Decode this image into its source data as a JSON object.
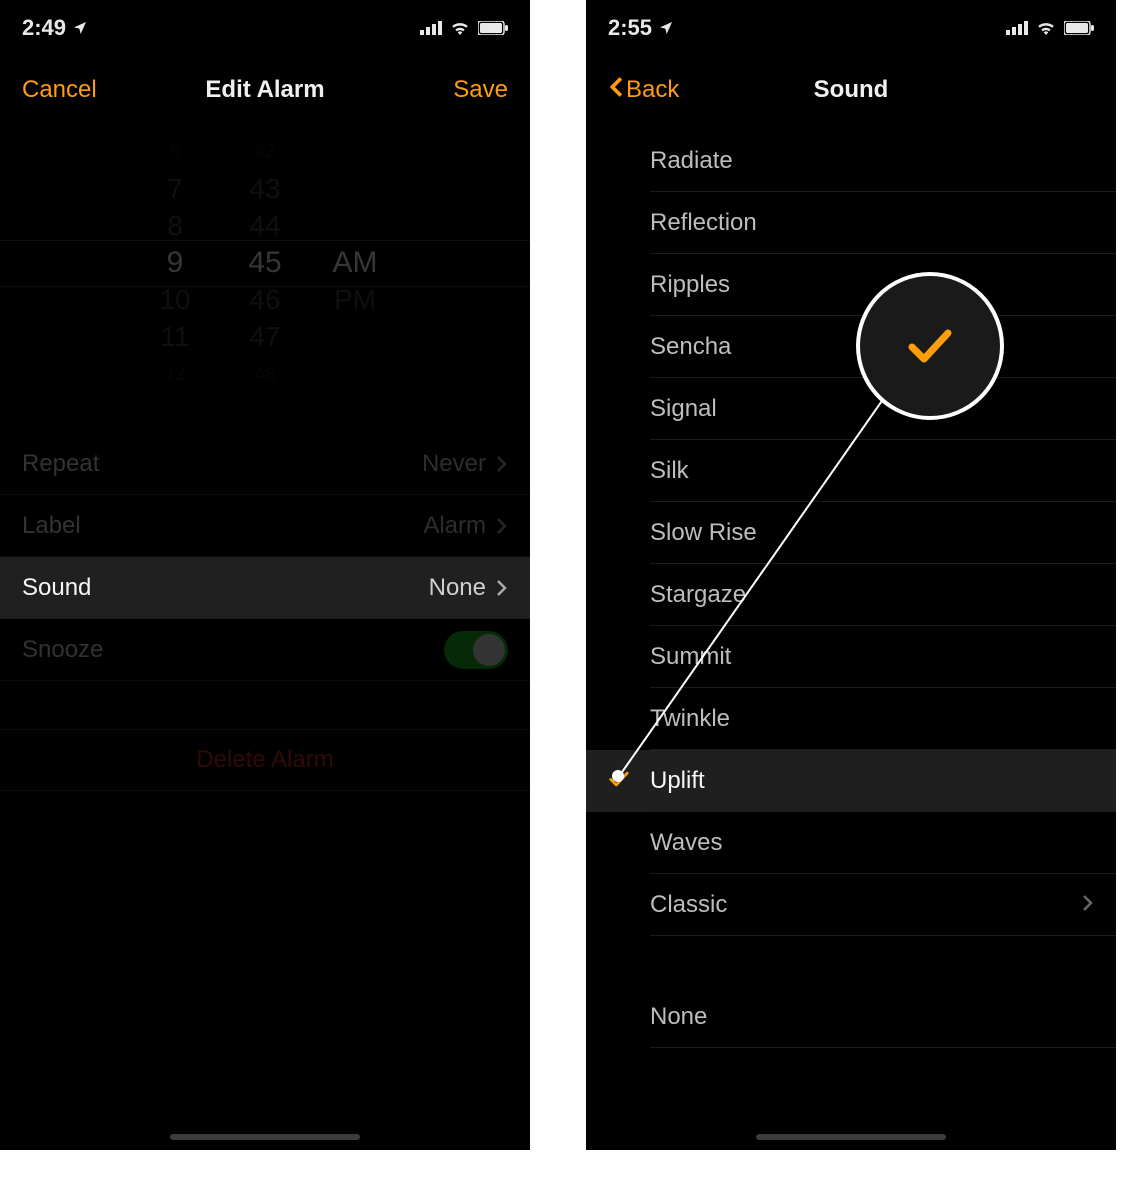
{
  "left": {
    "status_time": "2:49",
    "nav": {
      "left": "Cancel",
      "title": "Edit Alarm",
      "right": "Save"
    },
    "picker": {
      "hours": [
        "6",
        "7",
        "8",
        "9",
        "10",
        "11",
        "12"
      ],
      "mins": [
        "42",
        "43",
        "44",
        "45",
        "46",
        "47",
        "48"
      ],
      "ampm": [
        "AM",
        "PM"
      ],
      "sel_hour": "9",
      "sel_min": "45",
      "sel_ampm": "AM"
    },
    "rows": {
      "repeat_label": "Repeat",
      "repeat_value": "Never",
      "label_label": "Label",
      "label_value": "Alarm",
      "sound_label": "Sound",
      "sound_value": "None",
      "snooze_label": "Snooze",
      "snooze_on": true
    },
    "delete": "Delete Alarm"
  },
  "right": {
    "status_time": "2:55",
    "nav": {
      "back": "Back",
      "title": "Sound"
    },
    "sounds": [
      {
        "name": "Radiate"
      },
      {
        "name": "Reflection"
      },
      {
        "name": "Ripples"
      },
      {
        "name": "Sencha"
      },
      {
        "name": "Signal"
      },
      {
        "name": "Silk"
      },
      {
        "name": "Slow Rise"
      },
      {
        "name": "Stargaze"
      },
      {
        "name": "Summit"
      },
      {
        "name": "Twinkle"
      },
      {
        "name": "Uplift",
        "selected": true
      },
      {
        "name": "Waves"
      },
      {
        "name": "Classic",
        "disclosure": true
      }
    ],
    "none_label": "None"
  },
  "colors": {
    "accent": "#ff9d0b",
    "toggle_green": "#1aa61f",
    "delete_red": "#6b1713"
  }
}
